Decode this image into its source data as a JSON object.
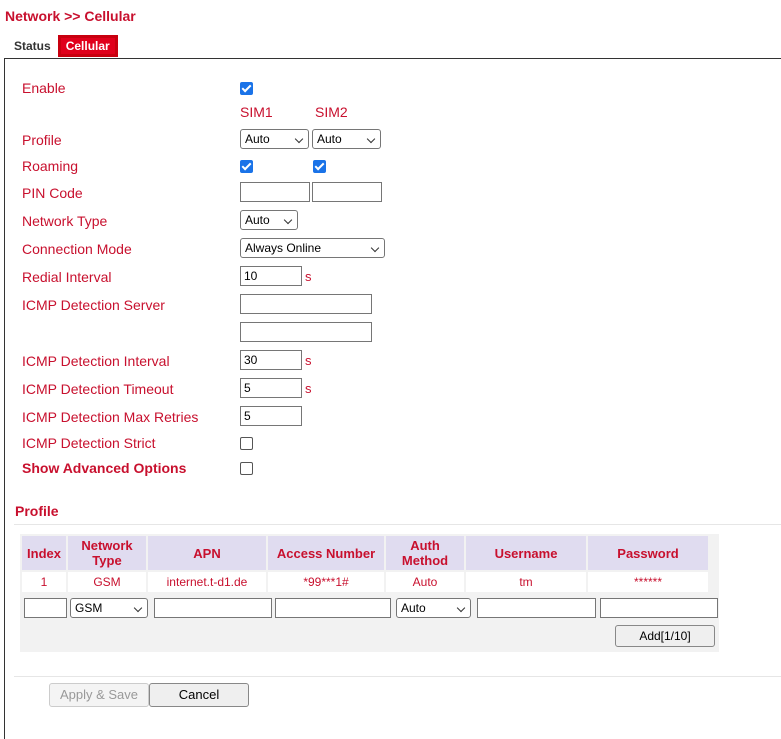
{
  "header": {
    "breadcrumb": "Network >> Cellular"
  },
  "tabs": [
    {
      "label": "Status",
      "active": false
    },
    {
      "label": "Cellular",
      "active": true
    }
  ],
  "form": {
    "enable": {
      "label": "Enable",
      "checked": true
    },
    "sim_headers": [
      "SIM1",
      "SIM2"
    ],
    "profile": {
      "label": "Profile",
      "sim1": "Auto",
      "sim2": "Auto"
    },
    "roaming": {
      "label": "Roaming",
      "sim1": true,
      "sim2": true
    },
    "pin_code": {
      "label": "PIN Code",
      "sim1": "",
      "sim2": ""
    },
    "network_type": {
      "label": "Network Type",
      "value": "Auto"
    },
    "connection_mode": {
      "label": "Connection Mode",
      "value": "Always Online"
    },
    "redial_interval": {
      "label": "Redial Interval",
      "value": "10",
      "unit": "s"
    },
    "icmp_server": {
      "label": "ICMP Detection Server",
      "value1": "",
      "value2": ""
    },
    "icmp_interval": {
      "label": "ICMP Detection Interval",
      "value": "30",
      "unit": "s"
    },
    "icmp_timeout": {
      "label": "ICMP Detection Timeout",
      "value": "5",
      "unit": "s"
    },
    "icmp_retries": {
      "label": "ICMP Detection Max Retries",
      "value": "5"
    },
    "icmp_strict": {
      "label": "ICMP Detection Strict",
      "checked": false
    },
    "advanced": {
      "label": "Show Advanced Options",
      "checked": false
    }
  },
  "profile_table": {
    "title": "Profile",
    "columns": [
      "Index",
      "Network Type",
      "APN",
      "Access Number",
      "Auth Method",
      "Username",
      "Password"
    ],
    "rows": [
      [
        "1",
        "GSM",
        "internet.t-d1.de",
        "*99***1#",
        "Auto",
        "tm",
        "******"
      ]
    ],
    "new_row": {
      "network_type": "GSM",
      "auth_method": "Auto"
    },
    "add_label": "Add[1/10]"
  },
  "footer": {
    "apply_label": "Apply & Save",
    "cancel_label": "Cancel"
  },
  "colors": {
    "accent": "#c8102e",
    "tab_active": "#e0001b",
    "checkbox": "#1a73e8",
    "table_header": "#e0dcf0"
  }
}
